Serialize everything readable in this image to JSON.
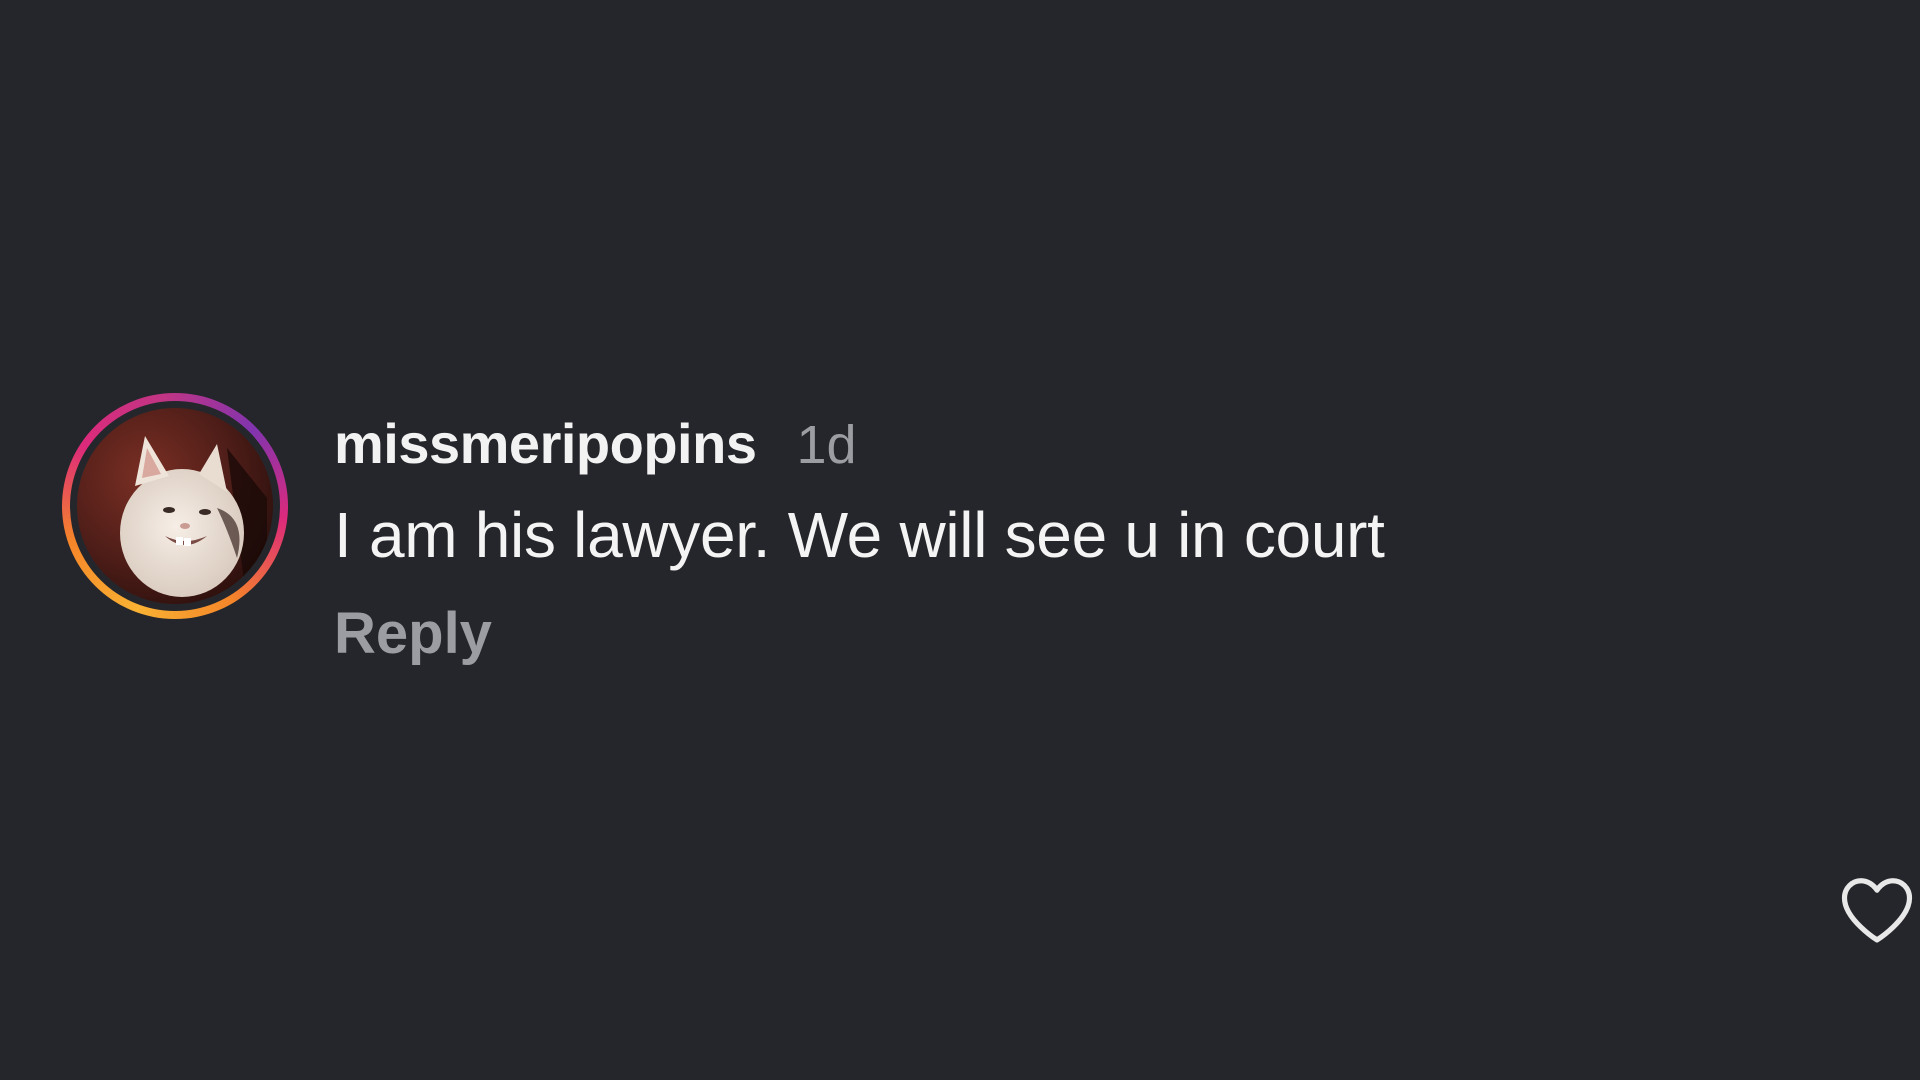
{
  "comment": {
    "username": "missmeripopins",
    "timestamp": "1d",
    "text": "I am his lawyer. We will see u in court",
    "reply_label": "Reply",
    "avatar_icon": "cat-avatar",
    "like_icon": "heart-outline-icon"
  },
  "colors": {
    "background": "#25262b",
    "primary_text": "#f2f2f2",
    "secondary_text": "#9b9da2",
    "story_ring_start": "#f9b233",
    "story_ring_end": "#c13584"
  }
}
